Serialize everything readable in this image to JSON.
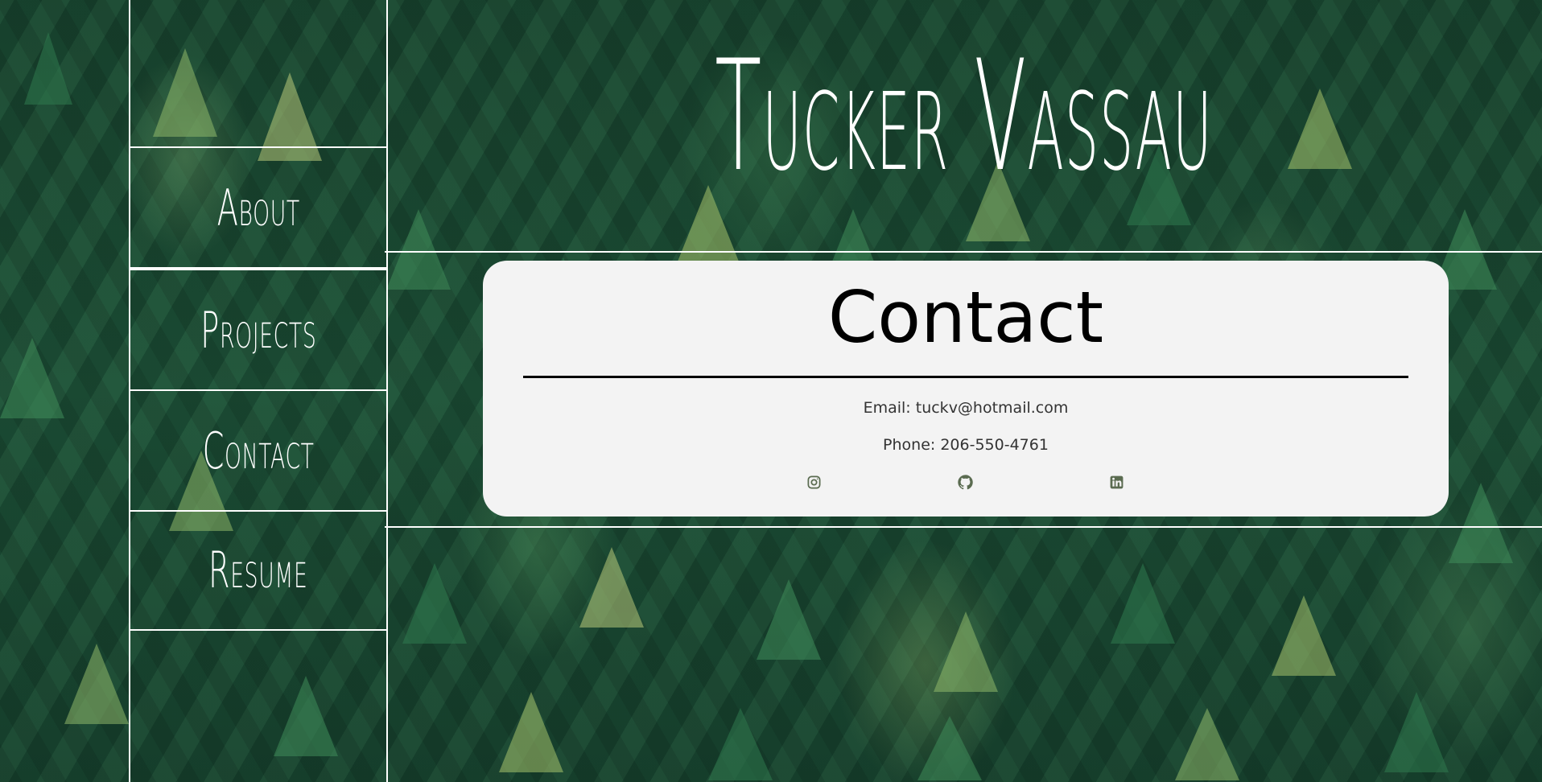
{
  "header": {
    "name": "Tucker Vassau"
  },
  "sidebar": {
    "items": [
      {
        "label": "About"
      },
      {
        "label": "Projects"
      },
      {
        "label": "Contact"
      },
      {
        "label": "Resume"
      }
    ]
  },
  "contact": {
    "title": "Contact",
    "email": "Email: tuckv@hotmail.com",
    "phone": "Phone: 206-550-4761",
    "icons": [
      "instagram-icon",
      "github-icon",
      "linkedin-icon"
    ]
  },
  "colors": {
    "background": "#1d5038",
    "card": "#f3f3f3",
    "icon": "#5a6b50",
    "lines": "#ffffff"
  }
}
